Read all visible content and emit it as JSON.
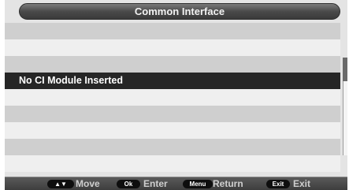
{
  "window": {
    "title": "Common Interface"
  },
  "list": {
    "items": [
      {
        "label": "No CI Module Inserted"
      }
    ]
  },
  "footer": {
    "move": {
      "key": "▲▼",
      "label": "Move"
    },
    "enter": {
      "key": "Ok",
      "label": "Enter"
    },
    "return": {
      "key": "Menu",
      "label": "Return"
    },
    "exit": {
      "key": "Exit",
      "label": "Exit"
    }
  }
}
